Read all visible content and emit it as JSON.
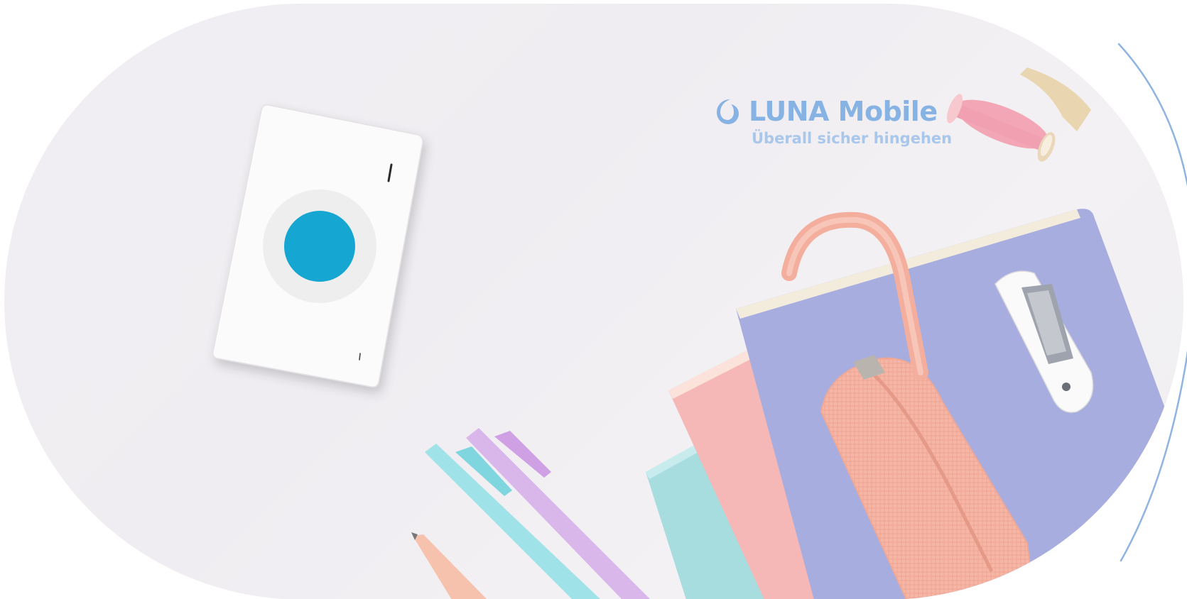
{
  "brand": {
    "name": "LUNA Mobile",
    "tagline": "Überall sicher hingehen",
    "logo_icon": "luna-crescent-icon"
  },
  "colors": {
    "brand_blue": "#86b3e3",
    "tagline_blue": "#a8c7ea",
    "device_button": "#17a6d2",
    "outline_arc": "#8fb4e2",
    "background": "#f0eef1"
  },
  "scene": {
    "objects": [
      "luna-mobile-device",
      "pink-washi-tape",
      "lavender-notebook",
      "pink-notebook",
      "turquoise-notebook",
      "pink-pencil-case",
      "white-stapler",
      "turquoise-pen",
      "lilac-pen",
      "peach-pen"
    ]
  }
}
